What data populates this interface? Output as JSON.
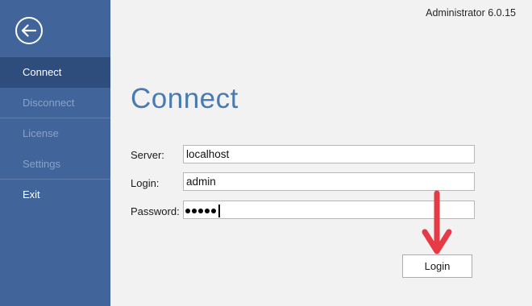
{
  "app": {
    "version_label": "Administrator 6.0.15"
  },
  "sidebar": {
    "back_icon": "arrow-left-circle-icon",
    "items": [
      {
        "label": "Connect",
        "state": "active"
      },
      {
        "label": "Disconnect",
        "state": "disabled"
      },
      {
        "label": "License",
        "state": "disabled"
      },
      {
        "label": "Settings",
        "state": "disabled"
      },
      {
        "label": "Exit",
        "state": "normal"
      }
    ]
  },
  "main": {
    "title": "Connect",
    "server": {
      "label": "Server:",
      "value": "localhost"
    },
    "login": {
      "label": "Login:",
      "value": "admin"
    },
    "password": {
      "label": "Password:",
      "masked_length": 5
    },
    "login_button": {
      "label": "Login"
    }
  },
  "annotation": {
    "icon": "red-arrow-down-icon",
    "color": "#e63b46"
  },
  "colors": {
    "sidebar": "#41659a",
    "sidebar_active": "#2f4d7c",
    "title": "#4a7bb0",
    "background": "#f2f2f2"
  }
}
